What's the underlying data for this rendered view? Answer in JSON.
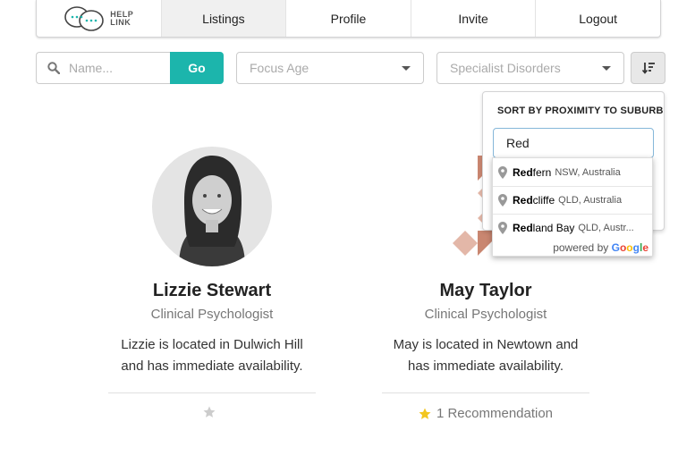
{
  "nav": {
    "logo_text_top": "HELP",
    "logo_text_bottom": "LINK",
    "items": [
      {
        "label": "Listings",
        "active": true
      },
      {
        "label": "Profile",
        "active": false
      },
      {
        "label": "Invite",
        "active": false
      },
      {
        "label": "Logout",
        "active": false
      }
    ]
  },
  "search": {
    "placeholder": "Name...",
    "button_label": "Go"
  },
  "filters": {
    "focus_age_placeholder": "Focus Age",
    "disorders_placeholder": "Specialist Disorders"
  },
  "sort_popup": {
    "title": "SORT BY PROXIMITY TO SUBURB",
    "input_value": "Red",
    "suggestions": [
      {
        "match": "Red",
        "rest": "fern",
        "secondary": "NSW, Australia"
      },
      {
        "match": "Red",
        "rest": "cliffe",
        "secondary": "QLD, Australia"
      },
      {
        "match": "Red",
        "rest": "land Bay",
        "secondary": "QLD, Austr..."
      }
    ],
    "powered_by": "powered by",
    "google": [
      "G",
      "o",
      "o",
      "g",
      "l",
      "e"
    ]
  },
  "cards": [
    {
      "name": "Lizzie Stewart",
      "role": "Clinical Psychologist",
      "description": "Lizzie is located in Dulwich Hill and has immediate availability.",
      "recommendations": "",
      "star_color": "#cccccc"
    },
    {
      "name": "May Taylor",
      "role": "Clinical Psychologist",
      "description": "May is located in Newtown and has immediate availability.",
      "recommendations": "1 Recommendation",
      "star_color": "#f2c61f"
    }
  ],
  "colors": {
    "accent": "#1cb5ac",
    "identicon": "#d9a393",
    "identicon_dark": "#b8735f"
  }
}
